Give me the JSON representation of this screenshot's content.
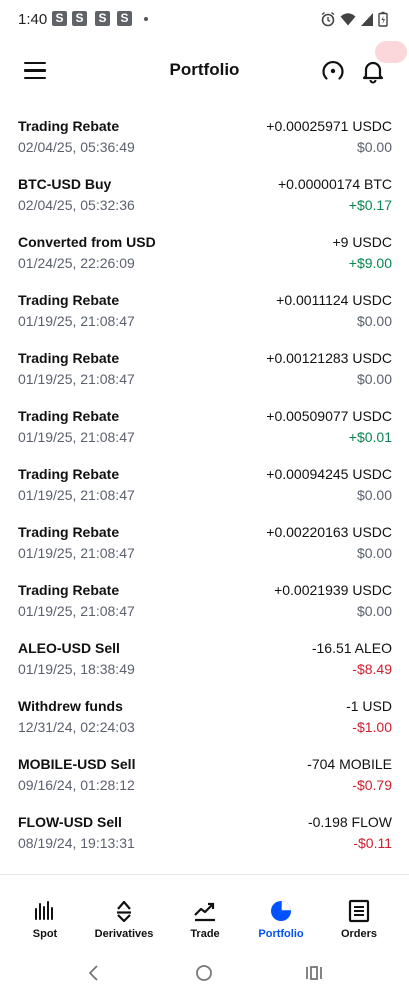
{
  "status_bar": {
    "time": "1:40",
    "notif_letters": [
      "S",
      "S",
      "S",
      "S"
    ]
  },
  "header": {
    "title": "Portfolio"
  },
  "transactions": [
    {
      "name": "Trading Rebate",
      "datetime": "02/04/25, 05:36:49",
      "amount": "+0.00025971 USDC",
      "value": "$0.00",
      "value_kind": "neutral"
    },
    {
      "name": "BTC-USD Buy",
      "datetime": "02/04/25, 05:32:36",
      "amount": "+0.00000174 BTC",
      "value": "+$0.17",
      "value_kind": "positive"
    },
    {
      "name": "Converted from USD",
      "datetime": "01/24/25, 22:26:09",
      "amount": "+9 USDC",
      "value": "+$9.00",
      "value_kind": "positive"
    },
    {
      "name": "Trading Rebate",
      "datetime": "01/19/25, 21:08:47",
      "amount": "+0.0011124 USDC",
      "value": "$0.00",
      "value_kind": "neutral"
    },
    {
      "name": "Trading Rebate",
      "datetime": "01/19/25, 21:08:47",
      "amount": "+0.00121283 USDC",
      "value": "$0.00",
      "value_kind": "neutral"
    },
    {
      "name": "Trading Rebate",
      "datetime": "01/19/25, 21:08:47",
      "amount": "+0.00509077 USDC",
      "value": "+$0.01",
      "value_kind": "positive"
    },
    {
      "name": "Trading Rebate",
      "datetime": "01/19/25, 21:08:47",
      "amount": "+0.00094245 USDC",
      "value": "$0.00",
      "value_kind": "neutral"
    },
    {
      "name": "Trading Rebate",
      "datetime": "01/19/25, 21:08:47",
      "amount": "+0.00220163 USDC",
      "value": "$0.00",
      "value_kind": "neutral"
    },
    {
      "name": "Trading Rebate",
      "datetime": "01/19/25, 21:08:47",
      "amount": "+0.0021939 USDC",
      "value": "$0.00",
      "value_kind": "neutral"
    },
    {
      "name": "ALEO-USD Sell",
      "datetime": "01/19/25, 18:38:49",
      "amount": "-16.51 ALEO",
      "value": "-$8.49",
      "value_kind": "negative"
    },
    {
      "name": "Withdrew funds",
      "datetime": "12/31/24, 02:24:03",
      "amount": "-1 USD",
      "value": "-$1.00",
      "value_kind": "negative"
    },
    {
      "name": "MOBILE-USD Sell",
      "datetime": "09/16/24, 01:28:12",
      "amount": "-704 MOBILE",
      "value": "-$0.79",
      "value_kind": "negative"
    },
    {
      "name": "FLOW-USD Sell",
      "datetime": "08/19/24, 19:13:31",
      "amount": "-0.198 FLOW",
      "value": "-$0.11",
      "value_kind": "negative"
    }
  ],
  "bottom_nav": {
    "tabs": [
      {
        "label": "Spot",
        "icon": "spot-bars-icon",
        "active": false
      },
      {
        "label": "Derivatives",
        "icon": "derivatives-icon",
        "active": false
      },
      {
        "label": "Trade",
        "icon": "trade-trend-icon",
        "active": false
      },
      {
        "label": "Portfolio",
        "icon": "portfolio-pie-icon",
        "active": true
      },
      {
        "label": "Orders",
        "icon": "orders-list-icon",
        "active": false
      }
    ]
  },
  "colors": {
    "accent": "#0052ff",
    "positive": "#098551",
    "negative": "#cf202f",
    "muted": "#5b616e"
  }
}
